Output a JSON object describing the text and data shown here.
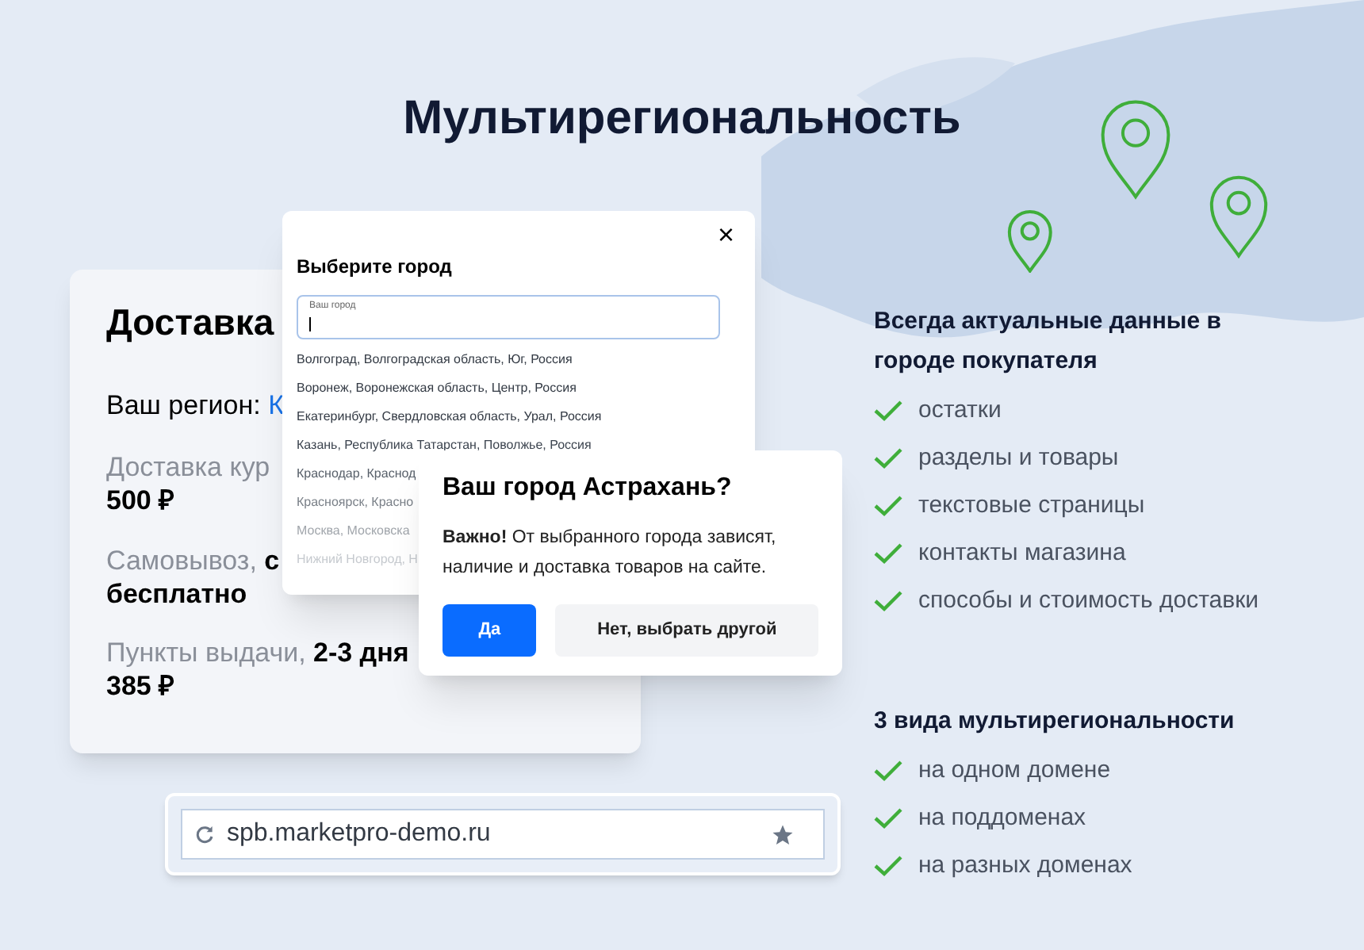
{
  "title": "Мультирегиональность",
  "delivery_card": {
    "title": "Доставка",
    "region_label": "Ваш регион: ",
    "region_value": "К",
    "rows": [
      {
        "label": "Доставка кур",
        "value": "",
        "price": "500 ₽"
      },
      {
        "label": "Самовывоз, ",
        "value": "с",
        "price": "бесплатно"
      },
      {
        "label": "Пункты выдачи, ",
        "value": "2-3 дня",
        "price": "385 ₽"
      }
    ]
  },
  "city_dialog": {
    "title": "Выберите город",
    "close": "×",
    "field_label": "Ваш город",
    "cities": [
      "Волгоград, Волгоградская область, Юг, Россия",
      "Воронеж, Воронежская область, Центр, Россия",
      "Екатеринбург, Свердловская область, Урал, Россия",
      "Казань, Республика Татарстан, Поволжье, Россия",
      "Краснодар, Краснод",
      "Красноярск, Красно",
      "Москва, Московска",
      "Нижний Новгород, Н"
    ]
  },
  "confirm_popup": {
    "title": "Ваш город Астрахань?",
    "text": "**Важно!** От выбранного города зависят, наличие и доставка товаров на сайте.",
    "yes": "Да",
    "no": "Нет, выбрать другой"
  },
  "address_bar": {
    "url": "spb.marketpro-demo.ru"
  },
  "features": [
    {
      "heading": "Всегда актуальные данные в городе покупателя",
      "items": [
        "остатки",
        "разделы и товары",
        "текстовые страницы",
        "контакты магазина",
        "способы и стоимость доставки"
      ]
    },
    {
      "heading": "3 вида мультирегиональности",
      "items": [
        "на одном домене",
        "на поддоменах",
        "на разных доменах"
      ]
    }
  ]
}
